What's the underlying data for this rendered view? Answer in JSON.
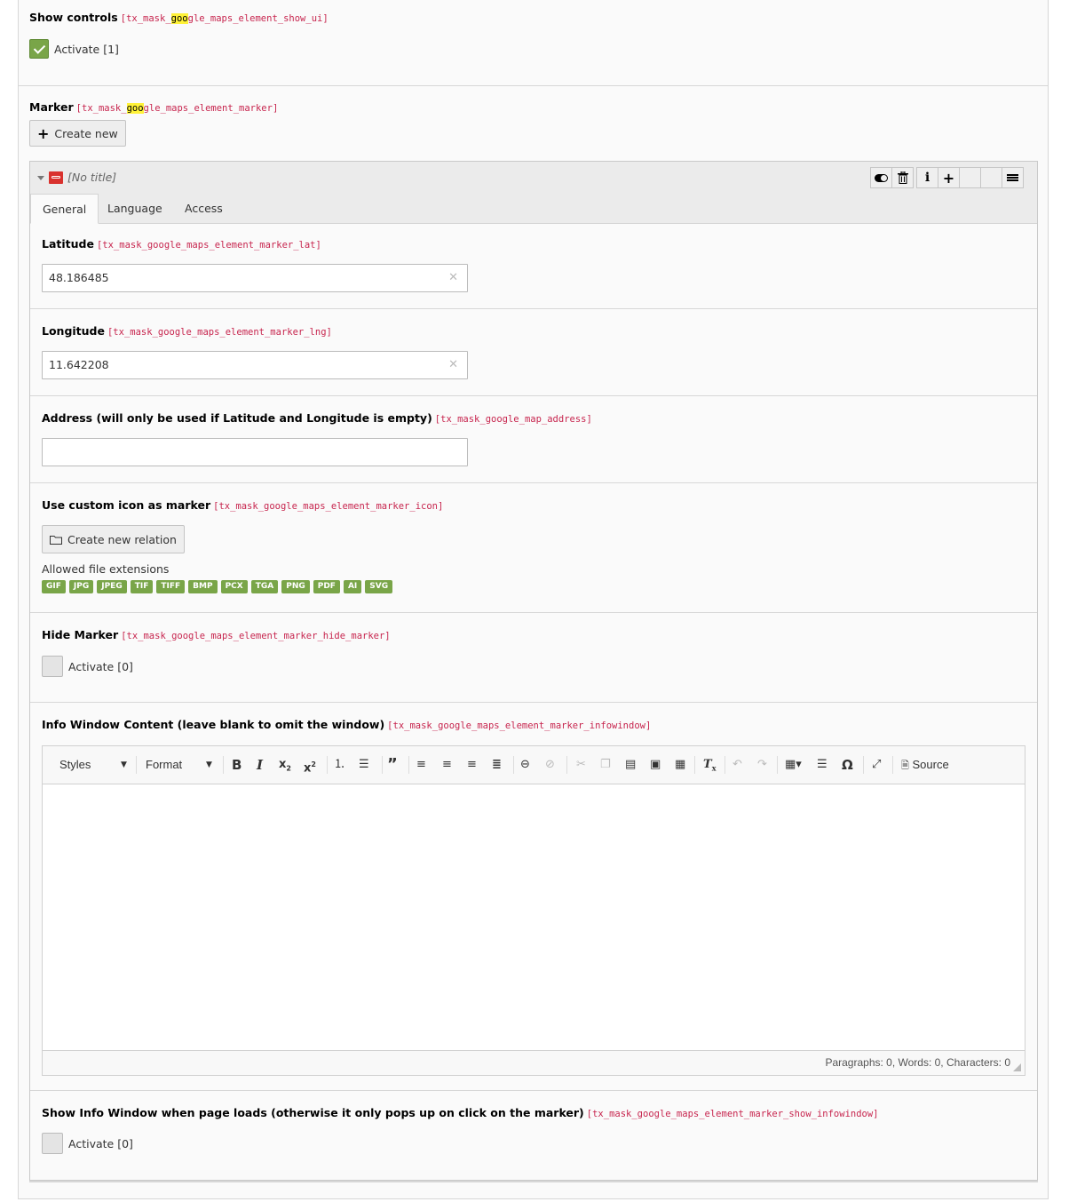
{
  "show_controls": {
    "label": "Show controls",
    "key_prefix": "[tx_mask_",
    "key_highlight": "goo",
    "key_suffix": "gle_maps_element_show_ui]",
    "checkbox_label": "Activate [1]",
    "checked": true
  },
  "marker": {
    "label": "Marker",
    "key_prefix": "[tx_mask_",
    "key_highlight": "goo",
    "key_suffix": "gle_maps_element_marker]",
    "create_new_label": "Create new"
  },
  "record": {
    "title": "[No title]",
    "controls": [
      "toggle-visibility",
      "delete",
      "info",
      "add",
      "empty-1",
      "empty-2",
      "drag-handle"
    ],
    "tabs": [
      {
        "label": "General",
        "active": true
      },
      {
        "label": "Language",
        "active": false
      },
      {
        "label": "Access",
        "active": false
      }
    ],
    "fields": {
      "latitude": {
        "label": "Latitude",
        "key": "[tx_mask_google_maps_element_marker_lat]",
        "value": "48.186485"
      },
      "longitude": {
        "label": "Longitude",
        "key": "[tx_mask_google_maps_element_marker_lng]",
        "value": "11.642208"
      },
      "address": {
        "label": "Address (will only be used if Latitude and Longitude is empty)",
        "key": "[tx_mask_google_map_address]",
        "value": ""
      },
      "icon": {
        "label": "Use custom icon as marker",
        "key": "[tx_mask_google_maps_element_marker_icon]",
        "button_label": "Create new relation",
        "allowed_label": "Allowed file extensions",
        "extensions": [
          "GIF",
          "JPG",
          "JPEG",
          "TIF",
          "TIFF",
          "BMP",
          "PCX",
          "TGA",
          "PNG",
          "PDF",
          "AI",
          "SVG"
        ]
      },
      "hide_marker": {
        "label": "Hide Marker",
        "key": "[tx_mask_google_maps_element_marker_hide_marker]",
        "checkbox_label": "Activate [0]",
        "checked": false
      },
      "infowindow": {
        "label": "Info Window Content (leave blank to omit the window)",
        "key": "[tx_mask_google_maps_element_marker_infowindow]",
        "toolbar": {
          "styles_label": "Styles",
          "format_label": "Format",
          "source_label": "Source"
        },
        "status": "Paragraphs: 0, Words: 0, Characters: 0"
      },
      "show_infowindow": {
        "label": "Show Info Window when page loads (otherwise it only pops up on click on the marker)",
        "key": "[tx_mask_google_maps_element_marker_show_infowindow]",
        "checkbox_label": "Activate [0]",
        "checked": false
      }
    }
  }
}
